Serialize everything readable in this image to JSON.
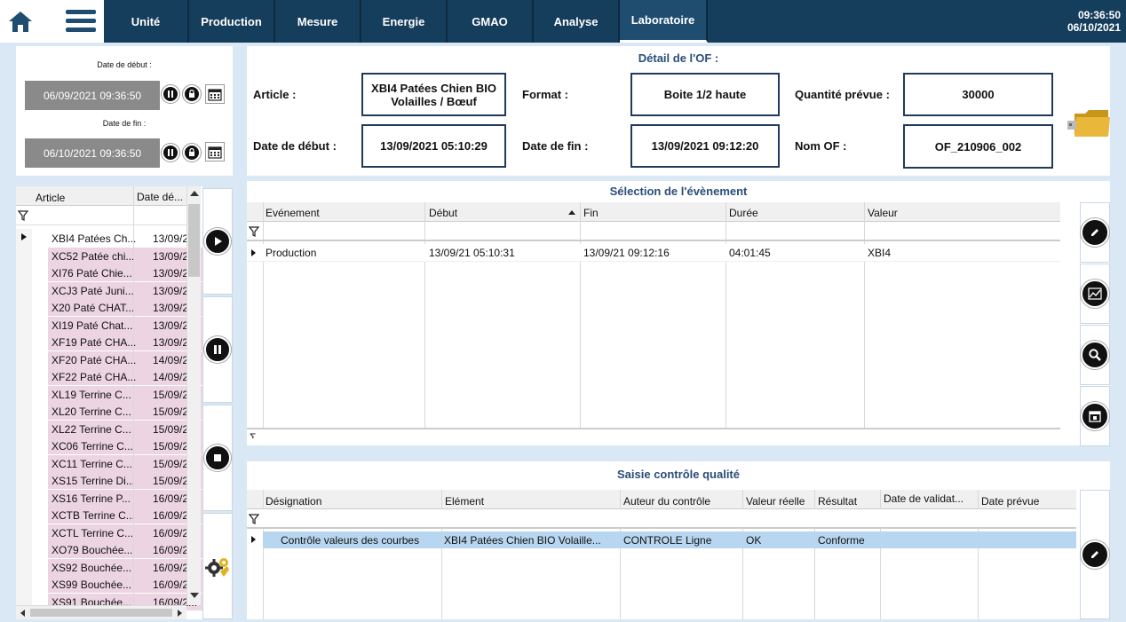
{
  "nav": {
    "tabs": [
      {
        "label": "Unité"
      },
      {
        "label": "Production"
      },
      {
        "label": "Mesure"
      },
      {
        "label": "Energie"
      },
      {
        "label": "GMAO"
      },
      {
        "label": "Analyse"
      },
      {
        "label": "Laboratoire"
      }
    ],
    "time": "09:36:50",
    "date": "06/10/2021"
  },
  "filter": {
    "start_label": "Date de début :",
    "start_value": "06/09/2021 09:36:50",
    "end_label": "Date de fin :",
    "end_value": "06/10/2021 09:36:50"
  },
  "article_list": {
    "headers": [
      "Article",
      "Date dé..."
    ],
    "rows": [
      {
        "article": "XBI4 Patées Ch...",
        "date": "13/09/2..."
      },
      {
        "article": "XC52 Patée chi...",
        "date": "13/09/2..."
      },
      {
        "article": "XI76 Paté Chie...",
        "date": "13/09/2..."
      },
      {
        "article": "XCJ3 Paté Juni...",
        "date": "13/09/2..."
      },
      {
        "article": "X20 Paté CHAT...",
        "date": "13/09/2..."
      },
      {
        "article": "XI19 Paté Chat...",
        "date": "13/09/2..."
      },
      {
        "article": "XF19 Paté CHA...",
        "date": "13/09/2..."
      },
      {
        "article": "XF20 Paté CHA...",
        "date": "14/09/2..."
      },
      {
        "article": "XF22 Paté CHA...",
        "date": "14/09/2..."
      },
      {
        "article": "XL19 Terrine C...",
        "date": "15/09/2..."
      },
      {
        "article": "XL20 Terrine C...",
        "date": "15/09/2..."
      },
      {
        "article": "XL22 Terrine C...",
        "date": "15/09/2..."
      },
      {
        "article": "XC06 Terrine C...",
        "date": "15/09/2..."
      },
      {
        "article": "XC11 Terrine C...",
        "date": "15/09/2..."
      },
      {
        "article": "XS15 Terrine Di...",
        "date": "15/09/2..."
      },
      {
        "article": "XS16 Terrine P...",
        "date": "16/09/2..."
      },
      {
        "article": "XCTB Terrine C...",
        "date": "16/09/2..."
      },
      {
        "article": "XCTL Terrine C...",
        "date": "16/09/2..."
      },
      {
        "article": "XO79 Bouchée...",
        "date": "16/09/2..."
      },
      {
        "article": "XS92 Bouchée...",
        "date": "16/09/2..."
      },
      {
        "article": "XS99 Bouchée...",
        "date": "16/09/2..."
      },
      {
        "article": "XS91 Bouchée...",
        "date": "16/09/2..."
      }
    ]
  },
  "of_detail": {
    "title": "Détail de l'OF :",
    "article_label": "Article :",
    "article_value_line1": "XBI4 Patées Chien BIO",
    "article_value_line2": "Volailles / Bœuf",
    "format_label": "Format :",
    "format_value": "Boite 1/2 haute",
    "quantity_label": "Quantité prévue :",
    "quantity_value": "30000",
    "start_label": "Date de début :",
    "start_value": "13/09/2021 05:10:29",
    "end_label": "Date de fin :",
    "end_value": "13/09/2021 09:12:20",
    "name_label": "Nom OF :",
    "name_value": "OF_210906_002"
  },
  "events": {
    "title": "Sélection de l'évènement",
    "headers": [
      "Evénement",
      "Début",
      "Fin",
      "Durée",
      "Valeur"
    ],
    "footer_symbol": "Σ",
    "rows": [
      {
        "event": "Production",
        "start": "13/09/21 05:10:31",
        "end": "13/09/21 09:12:16",
        "duration": "04:01:45",
        "value": "XBI4"
      }
    ]
  },
  "quality": {
    "title": "Saisie contrôle qualité",
    "headers": [
      "Désignation",
      "Elément",
      "Auteur du contrôle",
      "Valeur réelle",
      "Résultat",
      "Date de validat...",
      "Date prévue"
    ],
    "rows": [
      {
        "designation": "Contrôle valeurs des courbes",
        "element": "XBI4 Patées Chien BIO Volaille...",
        "author": "CONTROLE Ligne",
        "value": "OK",
        "result": "Conforme",
        "validated": "",
        "planned": ""
      }
    ]
  },
  "colors": {
    "nav_bg": "#153d5c",
    "accent": "#2a4d7a",
    "row_pink": "#ecd4e3",
    "row_selected": "#b8d6f0"
  }
}
